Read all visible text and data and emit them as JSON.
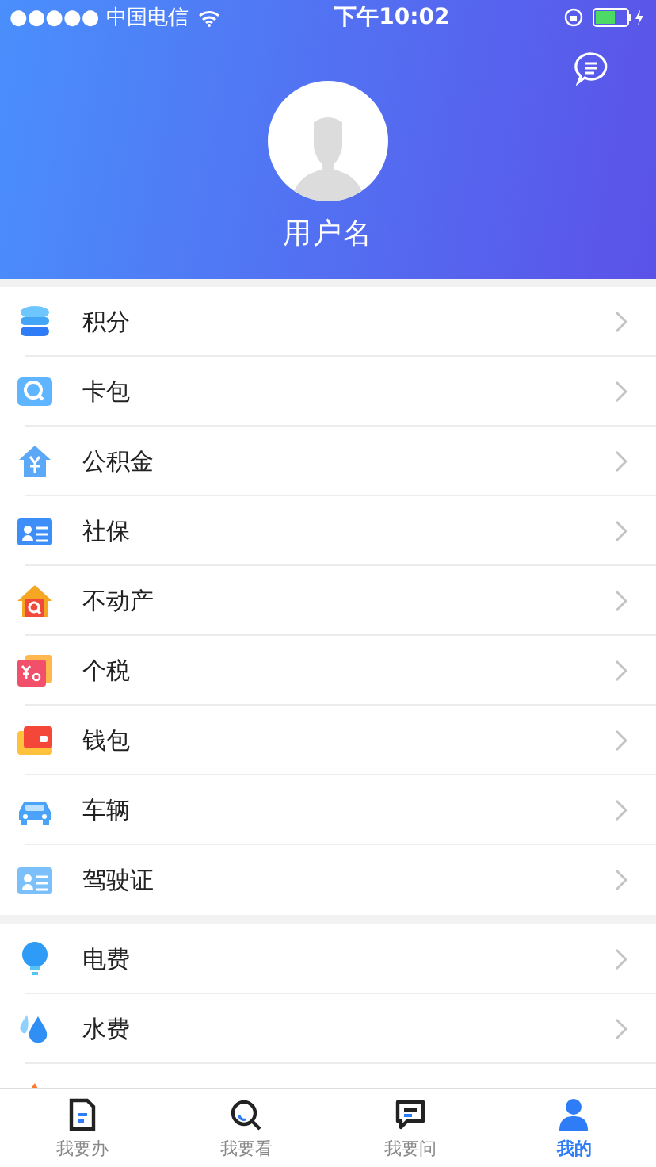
{
  "status_bar": {
    "carrier": "●●●●● 中国电信",
    "time": "下午10:02"
  },
  "profile": {
    "username": "用户名"
  },
  "menu_groups": [
    {
      "items": [
        {
          "label": "积分"
        },
        {
          "label": "卡包"
        },
        {
          "label": "公积金"
        },
        {
          "label": "社保"
        },
        {
          "label": "不动产"
        },
        {
          "label": "个税"
        },
        {
          "label": "钱包"
        },
        {
          "label": "车辆"
        },
        {
          "label": "驾驶证"
        }
      ]
    },
    {
      "items": [
        {
          "label": "电费"
        },
        {
          "label": "水费"
        }
      ]
    }
  ],
  "tab_bar": [
    {
      "label": "我要办",
      "selected": false
    },
    {
      "label": "我要看",
      "selected": false
    },
    {
      "label": "我要问",
      "selected": false
    },
    {
      "label": "我的",
      "selected": true
    }
  ]
}
